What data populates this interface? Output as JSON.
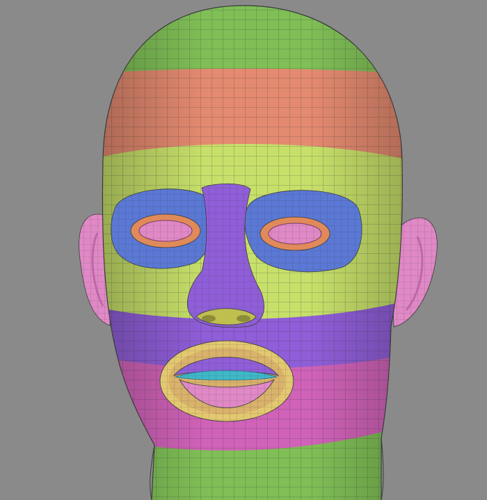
{
  "viewport": {
    "background": "#8a8a8a",
    "subject": "head-topology-mesh"
  },
  "palette": {
    "green": "#7fbf56",
    "salmon": "#e48a70",
    "yellow_green": "#c7e06a",
    "blue": "#5a78d4",
    "purple": "#8f5ed8",
    "magenta": "#d062b8",
    "pink": "#e089c6",
    "orange": "#e08a5a",
    "lip_yellow": "#e3c870",
    "lip_cyan": "#3fb8c8",
    "nostril_olive": "#bfbf50",
    "wire": "#3a3a3a"
  },
  "regions": [
    {
      "name": "skull-top",
      "color": "green"
    },
    {
      "name": "forehead-upper-band",
      "color": "salmon"
    },
    {
      "name": "forehead-lower-band",
      "color": "yellow_green"
    },
    {
      "name": "eye-loops",
      "color": "blue"
    },
    {
      "name": "eyelids",
      "color": "orange"
    },
    {
      "name": "eyeballs",
      "color": "pink"
    },
    {
      "name": "nose",
      "color": "purple"
    },
    {
      "name": "nostrils",
      "color": "nostril_olive"
    },
    {
      "name": "upper-lip-band",
      "color": "purple"
    },
    {
      "name": "mouth-loop",
      "color": "magenta"
    },
    {
      "name": "lip-border",
      "color": "lip_yellow"
    },
    {
      "name": "lip-line",
      "color": "lip_cyan"
    },
    {
      "name": "ears",
      "color": "pink"
    },
    {
      "name": "neck",
      "color": "green"
    }
  ]
}
